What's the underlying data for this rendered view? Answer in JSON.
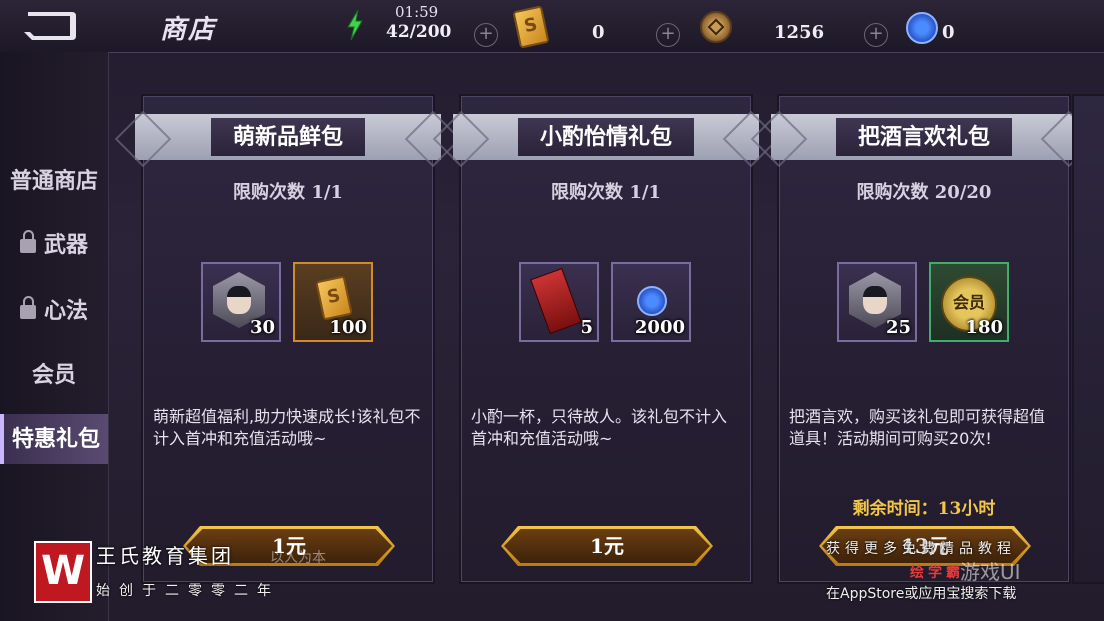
{
  "header": {
    "title": "商店",
    "stamina_timer": "01:59",
    "stamina": "42/200",
    "tickets": "0",
    "coins": "1256",
    "gems": "0"
  },
  "sidebar": {
    "items": [
      {
        "label": "普通商店",
        "locked": false
      },
      {
        "label": "武器",
        "locked": true
      },
      {
        "label": "心法",
        "locked": true
      },
      {
        "label": "会员",
        "locked": false
      },
      {
        "label": "特惠礼包",
        "locked": false,
        "active": true
      }
    ]
  },
  "packs": [
    {
      "name": "萌新品鲜包",
      "limit": "限购次数 1/1",
      "items": [
        {
          "icon": "character-portrait",
          "count": "30"
        },
        {
          "icon": "ticket-card",
          "count": "100"
        }
      ],
      "desc": "萌新超值福利,助力快速成长!该礼包不计入首冲和充值活动哦~",
      "price": "1元"
    },
    {
      "name": "小酌怡情礼包",
      "limit": "限购次数 1/1",
      "items": [
        {
          "icon": "red-scroll",
          "count": "5"
        },
        {
          "icon": "blue-shield-gem",
          "count": "2000"
        }
      ],
      "desc": "小酌一杯，只待故人。该礼包不计入首冲和充值活动哦~",
      "price": "1元"
    },
    {
      "name": "把酒言欢礼包",
      "limit": "限购次数 20/20",
      "items": [
        {
          "icon": "character-portrait",
          "count": "25"
        },
        {
          "icon": "vip-coin",
          "count": "180",
          "label": "会员"
        }
      ],
      "desc": "把酒言欢，购买该礼包即可获得超值道具！活动期间可购买20次!",
      "timer": "剩余时间：13小时",
      "price": "13元"
    }
  ],
  "watermark": {
    "logo": "W",
    "name": "王氏教育集团",
    "slogan": "始创于二零零二年",
    "grey": "以人为本",
    "right_line1": "获得更多免费精品教程",
    "right_brand": "绘学霸",
    "right_game": "游戏UI",
    "right_line2": "在AppStore或应用宝搜索下载"
  },
  "colors": {
    "accent_gold": "#f3c64a",
    "active_tab": "#5a4a72"
  }
}
